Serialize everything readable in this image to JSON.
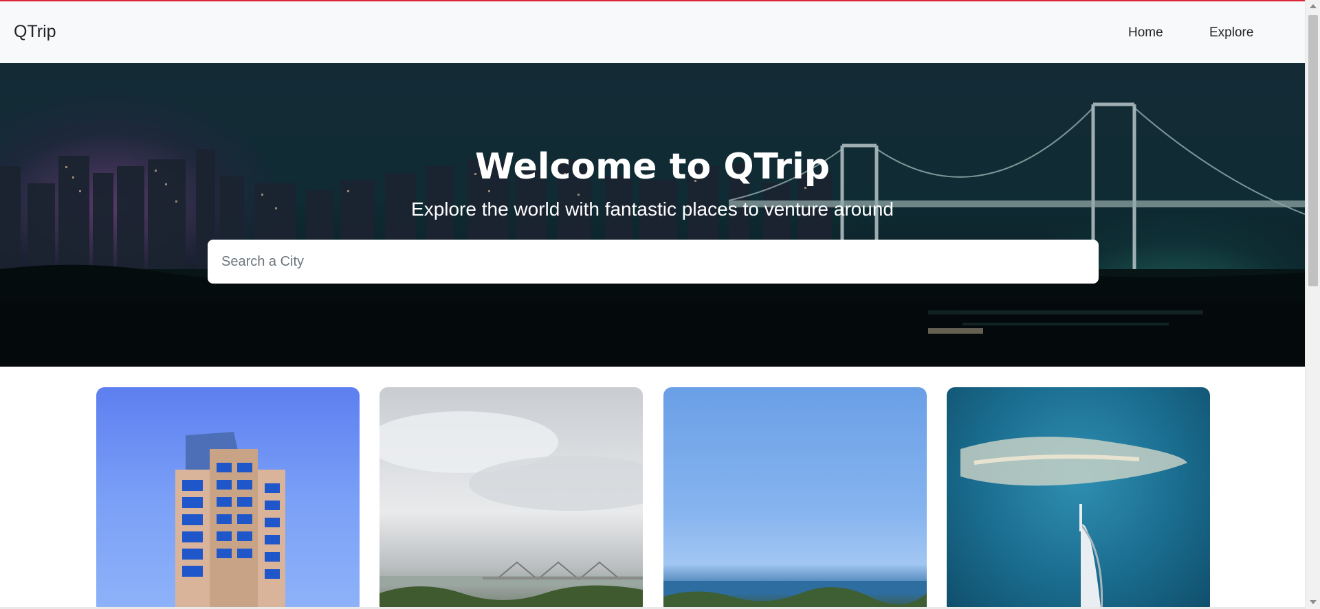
{
  "navbar": {
    "brand": "QTrip",
    "links": [
      {
        "label": "Home"
      },
      {
        "label": "Explore"
      }
    ]
  },
  "hero": {
    "title": "Welcome to QTrip",
    "subtitle": "Explore the world with fantastic places to venture around",
    "search": {
      "placeholder": "Search a City",
      "value": ""
    }
  },
  "cards": [
    {
      "image": "skyscraper-glass-building"
    },
    {
      "image": "river-bridge-cloudy-sky"
    },
    {
      "image": "sea-coast-blue-sky"
    },
    {
      "image": "palm-island-burj-al-arab"
    }
  ],
  "colors": {
    "accent_top_bar": "#d9263a",
    "navbar_bg": "#f8f9fa",
    "search_bg": "#ffffff"
  }
}
